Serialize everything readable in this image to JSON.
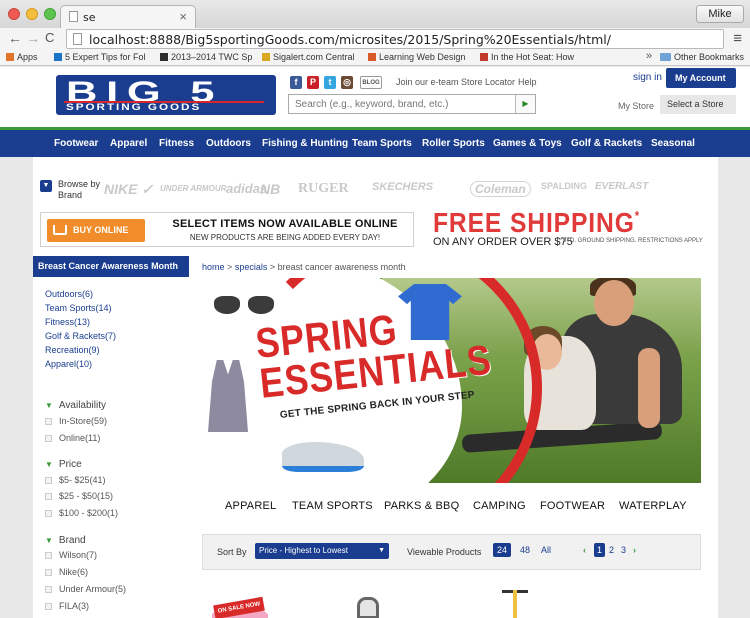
{
  "browser": {
    "tab_title": "se",
    "tab_close": "×",
    "user_name": "Mike",
    "nav_back": "←",
    "nav_forward": "→",
    "nav_reload": "C",
    "url": "localhost:8888/Big5sportingGoods.com/microsites/2015/Spring%20Essentials/html/",
    "menu": "≡",
    "bookmarks": [
      {
        "label": "Apps",
        "color": "#e2742b"
      },
      {
        "label": "5 Expert Tips for Fol",
        "color": "#1a73c7"
      },
      {
        "label": "2013–2014 TWC Sp",
        "color": "#2e2e2e"
      },
      {
        "label": "Sigalert.com Central",
        "color": "#d9a820"
      },
      {
        "label": "Learning Web Design",
        "color": "#d95b2a"
      },
      {
        "label": "In the Hot Seat: How",
        "color": "#c0392b"
      }
    ],
    "bookmarks_more": "»",
    "other_bookmarks": "Other Bookmarks"
  },
  "header": {
    "logo_big": "BIG 5",
    "logo_sub": "SPORTING GOODS",
    "social": [
      {
        "icon": "facebook-icon",
        "glyph": "f"
      },
      {
        "icon": "pinterest-icon",
        "glyph": "P"
      },
      {
        "icon": "twitter-icon",
        "glyph": "t"
      },
      {
        "icon": "instagram-icon",
        "glyph": "◎"
      },
      {
        "icon": "blog-icon",
        "glyph": "BLOG"
      }
    ],
    "links": [
      "Join our e-team",
      "Store Locator",
      "Help"
    ],
    "search_placeholder": "Search (e.g., keyword, brand, etc.)",
    "search_go": "▶",
    "sign_in": "sign in",
    "my_account": "My Account",
    "my_store_label": "My Store",
    "select_store": "Select a Store",
    "caret": "▼"
  },
  "main_nav": [
    "Footwear",
    "Apparel",
    "Fitness",
    "Outdoors",
    "Fishing & Hunting",
    "Team Sports",
    "Roller Sports",
    "Games & Toys",
    "Golf & Rackets",
    "Seasonal"
  ],
  "brands": {
    "label": "Browse by Brand",
    "toggle": "▼",
    "logos": [
      "NIKE ✓",
      "UNDER ARMOUR",
      "adidas",
      "NB",
      "RUGER",
      "SKECHERS",
      "Coleman",
      "SPALDING",
      "EVERLAST"
    ]
  },
  "promo": {
    "buy_online": "BUY ONLINE",
    "select_items": "SELECT ITEMS NOW AVAILABLE ONLINE",
    "new_products": "NEW PRODUCTS ARE BEING ADDED EVERY DAY!",
    "free_shipping": "FREE SHIPPING",
    "asterisk": "*",
    "any_order": "ON ANY ORDER OVER $75",
    "fine_print": "*STD. GROUND SHIPPING. RESTRICTIONS APPLY"
  },
  "sidebar": {
    "title": "Breast Cancer Awareness Month",
    "categories": [
      "Outdoors(6)",
      "Team Sports(14)",
      "Fitness(13)",
      "Golf & Rackets(7)",
      "Recreation(9)",
      "Apparel(10)"
    ],
    "chevron": "▼",
    "availability": {
      "title": "Availability",
      "options": [
        "In-Store(59)",
        "Online(11)"
      ]
    },
    "price": {
      "title": "Price",
      "options": [
        "$5- $25(41)",
        "$25 - $50(15)",
        "$100 - $200(1)"
      ]
    },
    "brand": {
      "title": "Brand",
      "options": [
        "Wilson(7)",
        "Nike(6)",
        "Under Armour(5)",
        "FILA(3)"
      ]
    }
  },
  "breadcrumb": {
    "home": "home",
    "sep": ">",
    "specials": "specials",
    "current": "breast cancer awareness month"
  },
  "hero": {
    "title_line1": "SPRING",
    "title_line2": "ESSENTIALS",
    "subtitle": "GET THE SPRING BACK IN YOUR STEP"
  },
  "category_tabs": [
    "APPAREL",
    "TEAM SPORTS",
    "PARKS & BBQ",
    "CAMPING",
    "FOOTWEAR",
    "WATERPLAY"
  ],
  "sort": {
    "label": "Sort By",
    "selected": "Price - Highest to Lowest",
    "caret": "▼",
    "viewable_label": "Viewable Products",
    "viewable_options": [
      "24",
      "48",
      "All"
    ],
    "viewable_selected": "24",
    "prev": "‹",
    "next": "›",
    "pages": [
      "1",
      "2",
      "3"
    ],
    "current_page": "1"
  },
  "products": {
    "on_sale_badge": "ON SALE NOW"
  }
}
